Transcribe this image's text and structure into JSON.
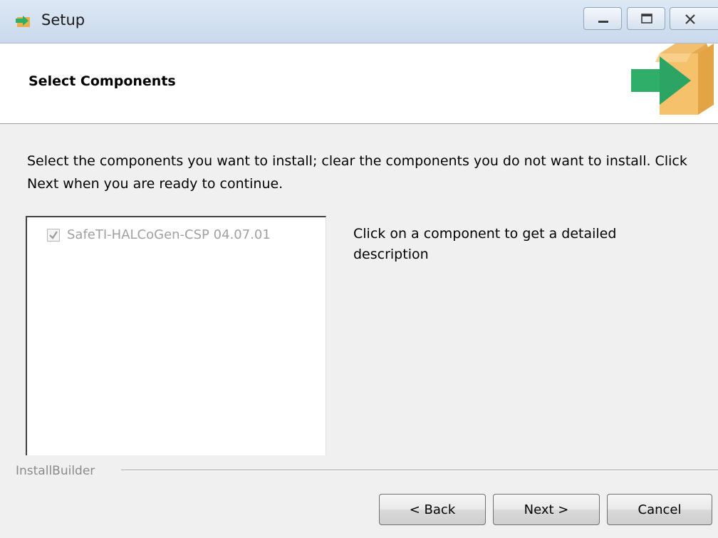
{
  "window": {
    "title": "Setup",
    "controls": {
      "minimize": "minimize-icon",
      "maximize": "maximize-icon",
      "close": "close-icon"
    }
  },
  "header": {
    "title": "Select Components",
    "icon": "installer-box-arrow-icon"
  },
  "intro_text": "Select the components you want to install; clear the components you do not want to install. Click Next when you are ready to continue.",
  "components": [
    {
      "label": "SafeTI-HALCoGen-CSP 04.07.01",
      "checked": true,
      "enabled": false
    }
  ],
  "description_text": "Click on a component to get a detailed description",
  "footer": {
    "brand": "InstallBuilder",
    "back_label": "< Back",
    "next_label": "Next >",
    "cancel_label": "Cancel"
  },
  "colors": {
    "titlebar": "#dde8f4",
    "box": "#f5c26b",
    "arrow": "#2fae6a"
  }
}
